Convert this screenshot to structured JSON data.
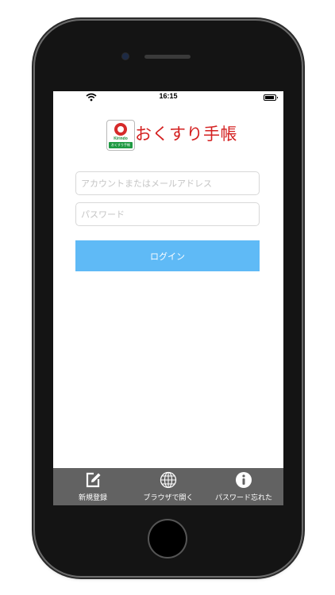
{
  "status_bar": {
    "time": "16:15"
  },
  "app": {
    "logo": {
      "brand": "Kirindo",
      "title": "おくすり手帳",
      "badge_caption": "おくすり手帳"
    },
    "login_form": {
      "account_placeholder": "アカウントまたはメールアドレス",
      "password_placeholder": "パスワード",
      "login_label": "ログイン"
    },
    "tabbar": {
      "items": [
        {
          "label": "新規登録",
          "icon": "edit-icon"
        },
        {
          "label": "ブラウザで開く",
          "icon": "globe-icon"
        },
        {
          "label": "パスワード忘れた",
          "icon": "info-icon"
        }
      ]
    }
  },
  "colors": {
    "login_button": "#5fbaf6",
    "tabbar": "#626262",
    "logo_red": "#d42020",
    "logo_green": "#1f9a43"
  }
}
